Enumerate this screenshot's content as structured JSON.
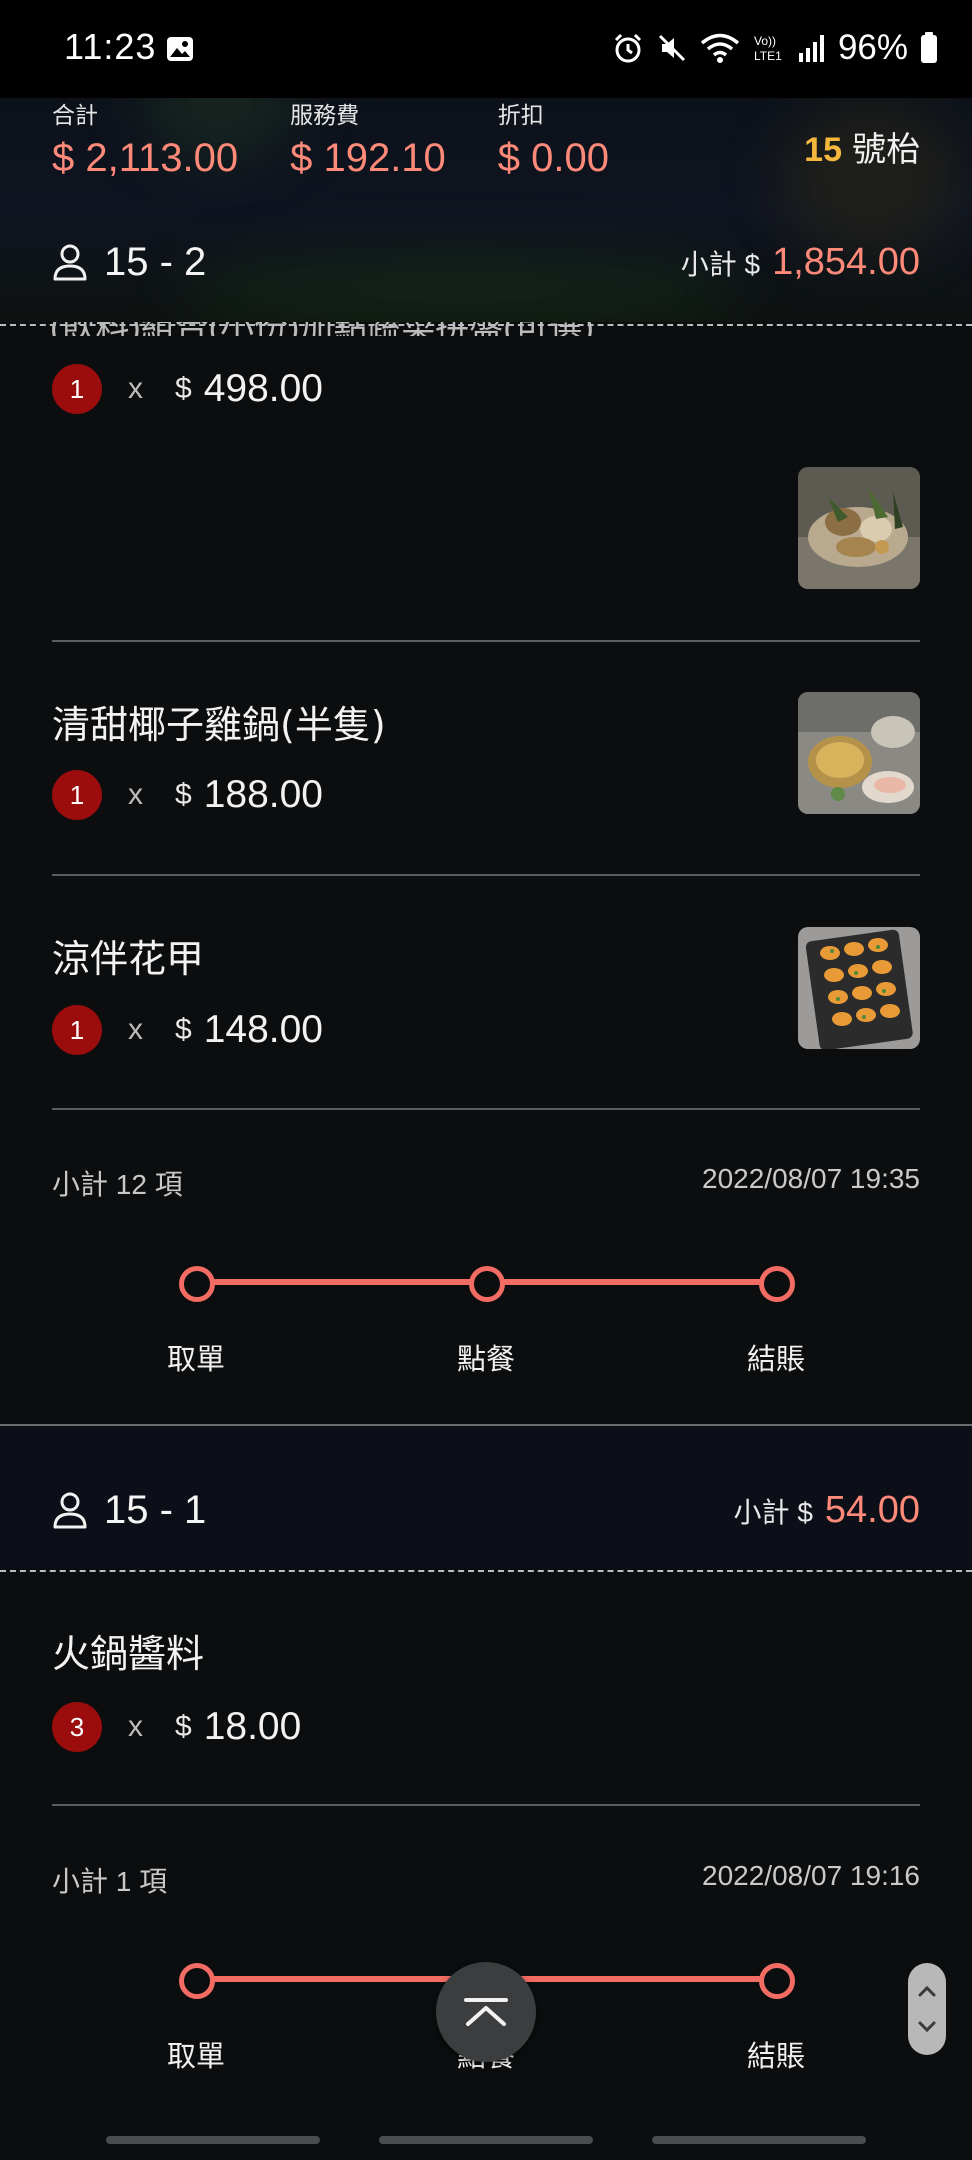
{
  "status_bar": {
    "time": "11:23",
    "battery": "96%",
    "icons": [
      "gallery-icon",
      "alarm-icon",
      "mute-icon",
      "wifi-icon",
      "volte-icon",
      "signal-icon",
      "battery-icon"
    ]
  },
  "header": {
    "totals": [
      {
        "label": "合計",
        "value": "$ 2,113.00"
      },
      {
        "label": "服務費",
        "value": "$ 192.10"
      },
      {
        "label": "折扣",
        "value": "$ 0.00"
      }
    ],
    "table_number": "15",
    "table_label": "號枱"
  },
  "orders": [
    {
      "person": "15 - 2",
      "subtotal_label": "小計 $",
      "subtotal_value": "1,854.00",
      "cut_text": "(飲料)組合(小份)加點蔬菜拼盤(可選)",
      "items": [
        {
          "name": "",
          "qty": "1",
          "x": "x",
          "currency": "$",
          "price": "498.00"
        },
        {
          "name": "清甜椰子雞鍋(半隻)",
          "qty": "1",
          "x": "x",
          "currency": "$",
          "price": "188.00"
        },
        {
          "name": "涼伴花甲",
          "qty": "1",
          "x": "x",
          "currency": "$",
          "price": "148.00"
        }
      ],
      "count": "小計 12 項",
      "datetime": "2022/08/07 19:35",
      "steps": [
        "取單",
        "點餐",
        "結賬"
      ]
    },
    {
      "person": "15 - 1",
      "subtotal_label": "小計 $",
      "subtotal_value": "54.00",
      "items": [
        {
          "name": "火鍋醬料",
          "qty": "3",
          "x": "x",
          "currency": "$",
          "price": "18.00"
        }
      ],
      "count": "小計 1 項",
      "datetime": "2022/08/07 19:16",
      "steps": [
        "取單",
        "點餐",
        "結賬"
      ]
    }
  ],
  "colors": {
    "accent": "#ff8a7a",
    "progress": "#f26c63",
    "badge": "#9b0d0d",
    "table_number": "#f5b83c"
  }
}
